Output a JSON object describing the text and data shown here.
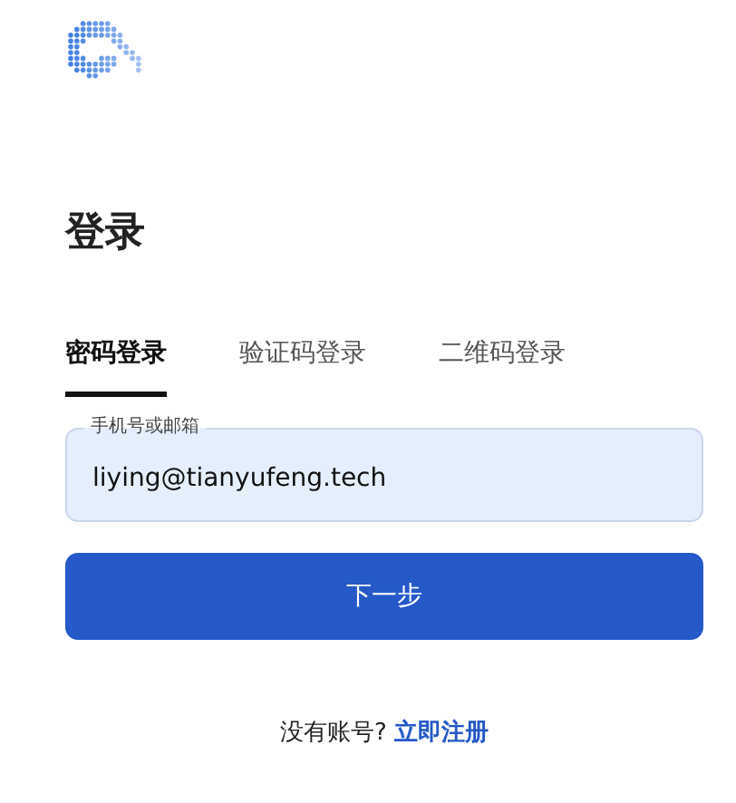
{
  "title": "登录",
  "tabs": [
    {
      "label": "密码登录",
      "selected": true
    },
    {
      "label": "验证码登录",
      "selected": false
    },
    {
      "label": "二维码登录",
      "selected": false
    }
  ],
  "field": {
    "label": "手机号或邮箱",
    "value": "liying@tianyufeng.tech"
  },
  "submit_button": "下一步",
  "footer": {
    "text": "没有账号?",
    "link": "立即注册"
  }
}
